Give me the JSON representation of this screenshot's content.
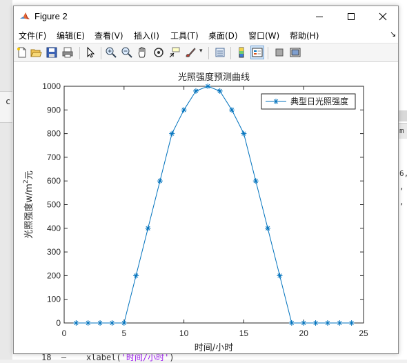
{
  "window": {
    "title": "Figure 2"
  },
  "background": {
    "left_char": "c",
    "right_text": [
      "m",
      "6,",
      ",",
      ","
    ],
    "code_line": {
      "number": "18",
      "dash": "—",
      "func": "xlabel(",
      "str": "'时间/小时'",
      "end": ")"
    }
  },
  "menus": [
    "文件(F)",
    "编辑(E)",
    "查看(V)",
    "插入(I)",
    "工具(T)",
    "桌面(D)",
    "窗口(W)",
    "帮助(H)"
  ],
  "toolbar_icons": [
    "new-figure-icon",
    "open-file-icon",
    "save-icon",
    "print-icon",
    "pointer-icon",
    "zoom-in-icon",
    "zoom-out-icon",
    "pan-icon",
    "rotate-icon",
    "data-cursor-icon",
    "brush-icon",
    "link-plot-icon",
    "colorbar-icon",
    "legend-icon",
    "hide-tools-icon",
    "show-tools-icon"
  ],
  "colors": {
    "series": "#0072bd",
    "axes": "#262626",
    "title": "#262626"
  },
  "chart_data": {
    "type": "line",
    "title": "光照强度预测曲线",
    "xlabel": "时间/小时",
    "ylabel": "光照强度w/m",
    "ylabel_sup": "2",
    "ylabel_suffix": "元",
    "xlim": [
      0,
      25
    ],
    "ylim": [
      0,
      1000
    ],
    "xticks": [
      0,
      5,
      10,
      15,
      20,
      25
    ],
    "yticks": [
      0,
      100,
      200,
      300,
      400,
      500,
      600,
      700,
      800,
      900,
      1000
    ],
    "grid": false,
    "legend_position": "top-right",
    "marker": "asterisk",
    "series": [
      {
        "name": "典型日光照强度",
        "x": [
          1,
          2,
          3,
          4,
          5,
          6,
          7,
          8,
          9,
          10,
          11,
          12,
          13,
          14,
          15,
          16,
          17,
          18,
          19,
          20,
          21,
          22,
          23,
          24
        ],
        "y": [
          0,
          0,
          0,
          0,
          0,
          200,
          400,
          600,
          800,
          900,
          980,
          1000,
          980,
          900,
          800,
          600,
          400,
          200,
          0,
          0,
          0,
          0,
          0,
          0
        ]
      }
    ]
  }
}
